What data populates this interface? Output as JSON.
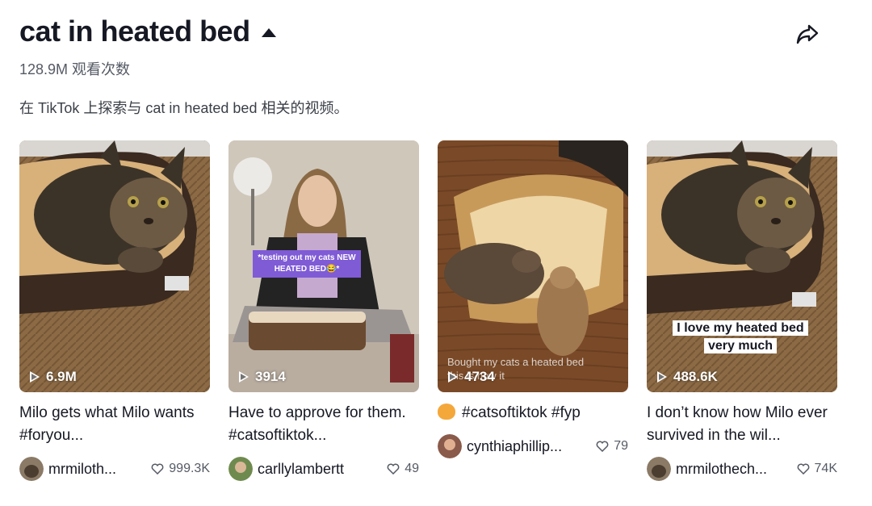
{
  "header": {
    "title": "cat in heated bed",
    "views": "128.9M 观看次数",
    "description": "在 TikTok 上探索与 cat in heated bed 相关的视频。"
  },
  "videos": [
    {
      "play_count": "6.9M",
      "title": "Milo gets what Milo wants #foryou...",
      "username": "mrmiloth...",
      "likes": "999.3K"
    },
    {
      "play_count": "3914",
      "overlay_text": "*testing out my cats NEW HEATED BED😂*",
      "title": "Have to approve for them. #catsoftiktok...",
      "username": "carllylambertt",
      "likes": "49"
    },
    {
      "play_count": "4734",
      "overlay_text": "Bought my cats a heated bed this is how it",
      "title": "#catsoftiktok #fyp",
      "title_icon": "cat-face-emoji-icon",
      "username": "cynthiaphillip...",
      "likes": "79"
    },
    {
      "play_count": "488.6K",
      "overlay_text_1": "I love my heated bed",
      "overlay_text_2": "very much",
      "title": "I don’t know how Milo ever survived in the wil...",
      "username": "mrmilothech...",
      "likes": "74K"
    }
  ]
}
